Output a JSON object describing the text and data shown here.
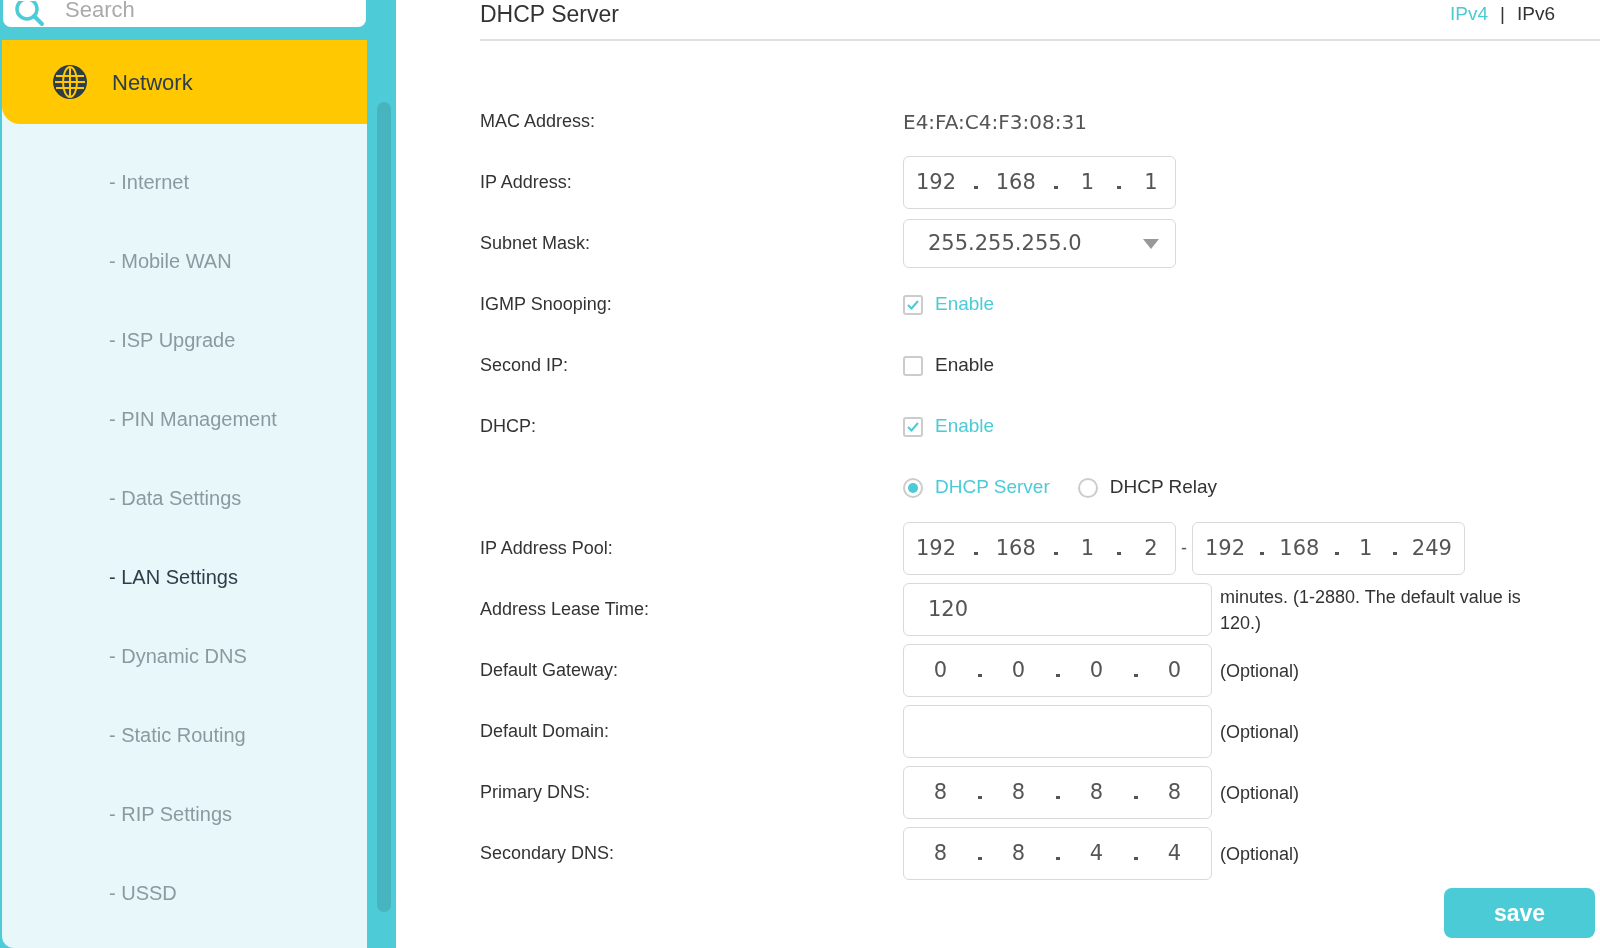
{
  "sidebar": {
    "search": {
      "placeholder": "Search"
    },
    "section": {
      "label": "Network",
      "selected": true
    },
    "items": [
      {
        "label": "- Internet",
        "selected": false
      },
      {
        "label": "- Mobile WAN",
        "selected": false
      },
      {
        "label": "- ISP Upgrade",
        "selected": false
      },
      {
        "label": "- PIN Management",
        "selected": false
      },
      {
        "label": "- Data Settings",
        "selected": false
      },
      {
        "label": "- LAN Settings",
        "selected": true
      },
      {
        "label": "- Dynamic DNS",
        "selected": false
      },
      {
        "label": "- Static Routing",
        "selected": false
      },
      {
        "label": "- RIP Settings",
        "selected": false
      },
      {
        "label": "- USSD",
        "selected": false
      }
    ]
  },
  "main": {
    "title": "DHCP Server",
    "tab_separator": "|",
    "tabs": [
      {
        "label": "IPv4",
        "selected": true
      },
      {
        "label": "IPv6",
        "selected": false
      }
    ],
    "fields": [
      {
        "kind": "text",
        "label": "MAC Address:",
        "value": "E4:FA:C4:F3:08:31"
      },
      {
        "kind": "ip",
        "label": "IP Address:",
        "octets": [
          "192",
          "168",
          "1",
          "1"
        ]
      },
      {
        "kind": "select",
        "label": "Subnet Mask:",
        "value": "255.255.255.0"
      },
      {
        "kind": "checkbox",
        "label": "IGMP Snooping:",
        "option": "Enable",
        "checked": true
      },
      {
        "kind": "checkbox",
        "label": "Second IP:",
        "option": "Enable",
        "checked": false
      },
      {
        "kind": "checkbox",
        "label": "DHCP:",
        "option": "Enable",
        "checked": true
      },
      {
        "kind": "radio",
        "options": [
          {
            "label": "DHCP Server",
            "selected": true
          },
          {
            "label": "DHCP Relay",
            "selected": false
          }
        ]
      },
      {
        "kind": "range",
        "label": "IP Address Pool:",
        "from": [
          "192",
          "168",
          "1",
          "2"
        ],
        "separator": "-",
        "to": [
          "192",
          "168",
          "1",
          "249"
        ]
      },
      {
        "kind": "input",
        "label": "Address Lease Time:",
        "value": "120",
        "note": "minutes. (1-2880. The default value is 120.)"
      },
      {
        "kind": "ip_wide",
        "label": "Default Gateway:",
        "octets": [
          "0",
          "0",
          "0",
          "0"
        ],
        "note": "(Optional)"
      },
      {
        "kind": "input",
        "label": "Default Domain:",
        "note": "(Optional)"
      },
      {
        "kind": "ip_wide",
        "label": "Primary DNS:",
        "octets": [
          "8",
          "8",
          "8",
          "8"
        ],
        "note": "(Optional)"
      },
      {
        "kind": "ip_wide",
        "label": "Secondary DNS:",
        "octets": [
          "8",
          "8",
          "4",
          "4"
        ],
        "note": "(Optional)"
      }
    ],
    "save": "save"
  }
}
